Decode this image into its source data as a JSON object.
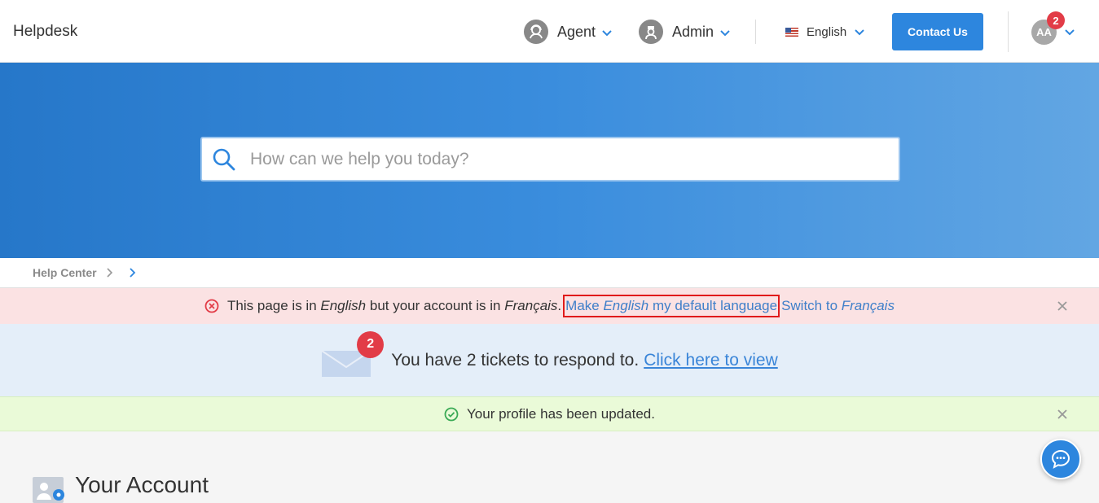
{
  "header": {
    "brand": "Helpdesk",
    "agent_label": "Agent",
    "admin_label": "Admin",
    "language_label": "English",
    "contact_label": "Contact Us",
    "user_initials": "AA",
    "user_badge": "2"
  },
  "hero": {
    "search_placeholder": "How can we help you today?"
  },
  "breadcrumb": {
    "root": "Help Center"
  },
  "language_alert": {
    "text_1": "This page is in ",
    "lang_1": "English",
    "text_2": " but your account is in ",
    "lang_2": "Français",
    "text_3": ".",
    "make_default_1": "Make ",
    "make_default_lang": "English",
    "make_default_2": " my default language",
    "switch_1": "Switch to ",
    "switch_lang": "Français"
  },
  "tickets": {
    "badge": "2",
    "message": "You have 2 tickets to respond to.",
    "link": "Click here to view"
  },
  "success_alert": {
    "message": "Your profile has been updated."
  },
  "section": {
    "title": "Your Account"
  },
  "colors": {
    "primary": "#2d86de",
    "badge": "#e23c47",
    "error_bg": "#fbe2e3",
    "info_bg": "#e4eef9",
    "success_bg": "#eafad8"
  }
}
